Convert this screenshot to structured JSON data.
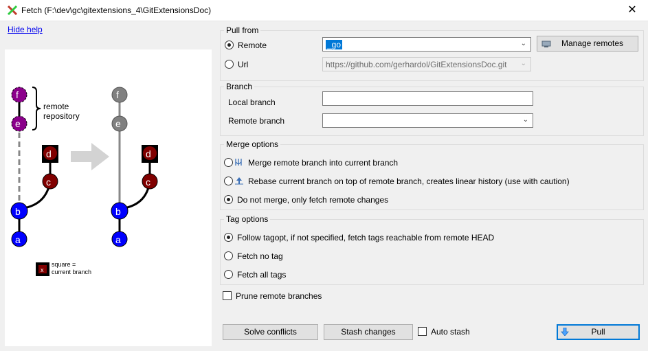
{
  "window": {
    "title": "Fetch (F:\\dev\\gc\\gitextensions_4\\GitExtensionsDoc)",
    "close_glyph": "✕"
  },
  "help": {
    "link_label": "Hide help"
  },
  "diagram": {
    "commit_labels": [
      "f",
      "e",
      "d",
      "c",
      "b",
      "a"
    ],
    "remote_label_1": "remote",
    "remote_label_2": "repository",
    "legend_symbol": "x",
    "legend_line1": "square =",
    "legend_line2": "current branch"
  },
  "pull_from": {
    "legend": "Pull from",
    "remote_label": "Remote",
    "remote_value": "_go",
    "url_label": "Url",
    "url_value": "https://github.com/gerhardol/GitExtensionsDoc.git",
    "manage_remotes": "Manage remotes"
  },
  "branch": {
    "legend": "Branch",
    "local_label": "Local branch",
    "local_value": "",
    "remote_label": "Remote branch",
    "remote_value": ""
  },
  "merge": {
    "legend": "Merge options",
    "opt_merge": "Merge remote branch into current branch",
    "opt_rebase": "Rebase current branch on top of remote branch, creates linear history (use with caution)",
    "opt_fetch": "Do not merge, only fetch remote changes"
  },
  "tags": {
    "legend": "Tag options",
    "opt_follow": "Follow tagopt, if not specified, fetch tags reachable from remote HEAD",
    "opt_no": "Fetch no tag",
    "opt_all": "Fetch all tags"
  },
  "prune_label": "Prune remote branches",
  "footer": {
    "solve": "Solve conflicts",
    "stash": "Stash changes",
    "auto_stash": "Auto stash",
    "pull": "Pull"
  },
  "colors": {
    "purple": "#8b008b",
    "darkred": "#800000",
    "blue": "#0000ff",
    "gray": "#808080",
    "accent": "#0078d7"
  },
  "icons": [
    "app-icon",
    "close-icon",
    "manage-remotes-icon",
    "merge-icon",
    "rebase-icon",
    "pull-icon",
    "dropdown-arrow-icon"
  ]
}
